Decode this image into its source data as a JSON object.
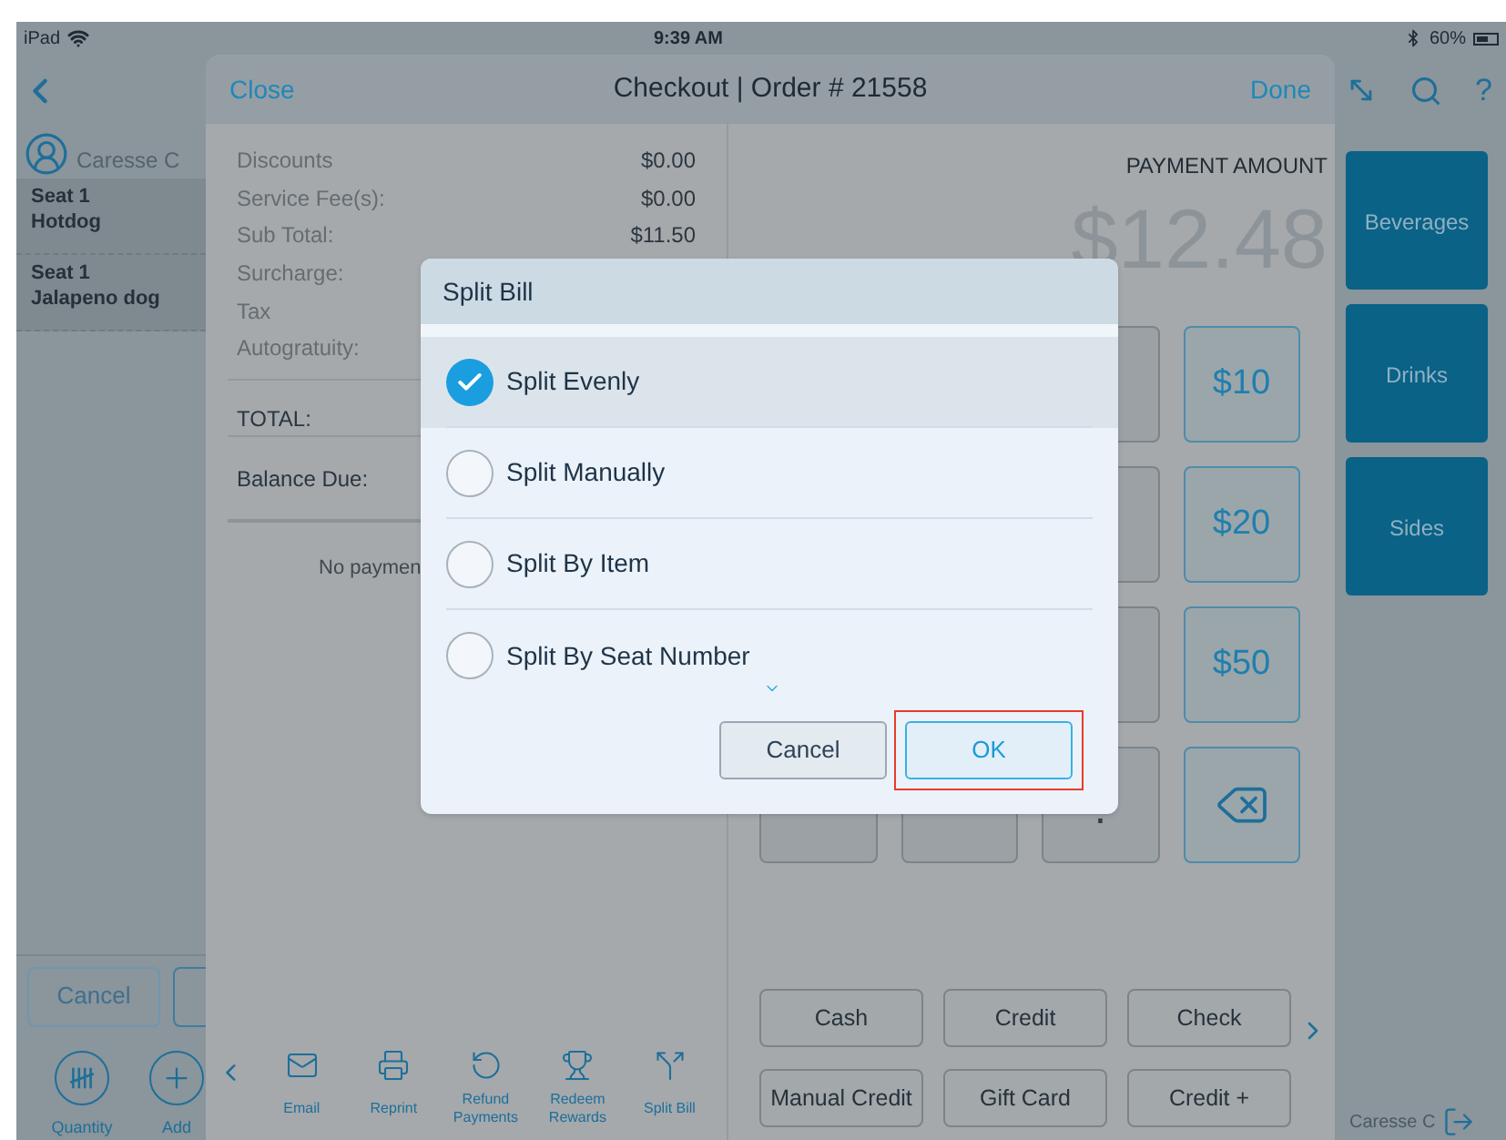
{
  "status_bar": {
    "carrier": "iPad",
    "time": "9:39 AM",
    "battery": "60%"
  },
  "left_panel": {
    "user": "Caresse C",
    "orders": [
      {
        "seat": "Seat 1",
        "item": "Hotdog"
      },
      {
        "seat": "Seat 1",
        "item": "Jalapeno dog"
      }
    ],
    "cancel_button": "Cancel",
    "tools": [
      {
        "label": "Quantity",
        "kind": "tally"
      },
      {
        "label": "Add",
        "kind": "plus"
      }
    ]
  },
  "checkout": {
    "close": "Close",
    "title": "Checkout | Order # 21558",
    "done": "Done",
    "summary": [
      {
        "label": "Discounts",
        "value": "$0.00"
      },
      {
        "label": "Service Fee(s):",
        "value": "$0.00"
      },
      {
        "label": "Sub Total:",
        "value": "$11.50"
      },
      {
        "label": "Surcharge:"
      },
      {
        "label": "Tax"
      },
      {
        "label": "Autogratuity:"
      }
    ],
    "totals": [
      {
        "label": "TOTAL:"
      },
      {
        "label": "Balance Due:"
      }
    ],
    "payments_note": "No paymen",
    "actions": [
      {
        "label": "Email",
        "kind": "mail"
      },
      {
        "label": "Reprint",
        "kind": "print"
      },
      {
        "label": "Refund Payments",
        "kind": "refund"
      },
      {
        "label": "Redeem Rewards",
        "kind": "trophy"
      },
      {
        "label": "Split Bill",
        "kind": "split"
      }
    ],
    "payment_amount_label": "PAYMENT AMOUNT",
    "payment_amount": "$12.48",
    "quick_keys": [
      "$10",
      "$20",
      "$50"
    ],
    "bottom_keys": [
      {
        "kind": "digit"
      },
      {
        "kind": "digit"
      },
      {
        "label": ".",
        "kind": "digit"
      },
      {
        "kind": "backspace"
      }
    ],
    "methods": [
      "Cash",
      "Credit",
      "Check",
      "Manual Credit",
      "Gift Card",
      "Credit +"
    ]
  },
  "side_menu": {
    "help": "?",
    "categories": [
      "Beverages",
      "Drinks",
      "Sides"
    ],
    "user": "Caresse C"
  },
  "dialog": {
    "title": "Split Bill",
    "options": [
      {
        "label": "Split Evenly",
        "selected": true
      },
      {
        "label": "Split Manually",
        "selected": false
      },
      {
        "label": "Split By Item",
        "selected": false
      },
      {
        "label": "Split By Seat Number",
        "selected": false
      }
    ],
    "buttons": [
      {
        "label": "Cancel",
        "kind": "secondary",
        "highlighted": false
      },
      {
        "label": "OK",
        "kind": "primary",
        "highlighted": true
      }
    ]
  }
}
